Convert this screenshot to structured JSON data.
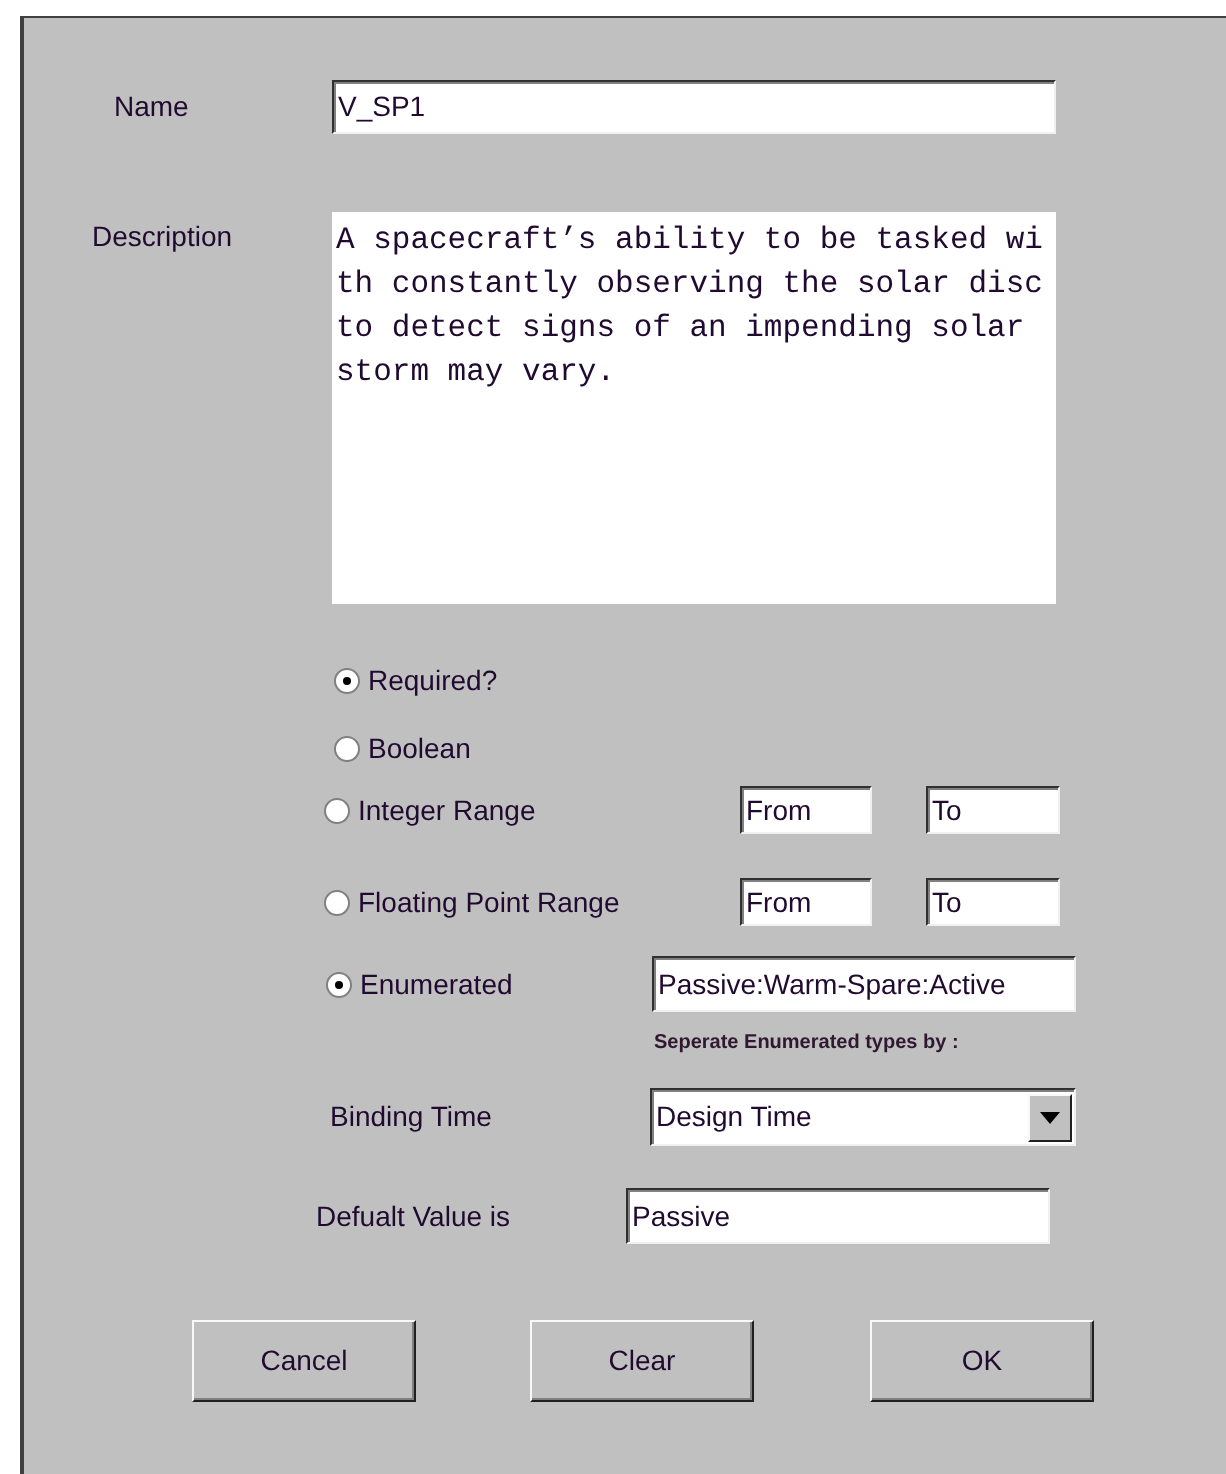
{
  "name": {
    "label": "Name",
    "value": "V_SP1"
  },
  "description": {
    "label": "Description",
    "value": "A spacecraft’s ability to be tasked with constantly observing the solar disc to detect signs of an impending solar storm may vary."
  },
  "options": [
    {
      "kind": "plain",
      "label": "Required?",
      "checked": true
    },
    {
      "kind": "plain",
      "label": "Boolean",
      "checked": false
    },
    {
      "kind": "range",
      "label": "Integer Range",
      "checked": false,
      "from": "From",
      "to": "To"
    },
    {
      "kind": "range",
      "label": "Floating Point Range",
      "checked": false,
      "from": "From",
      "to": "To"
    },
    {
      "kind": "enumerated",
      "label": "Enumerated",
      "checked": true,
      "value": "Passive:Warm-Spare:Active",
      "hint": "Seperate Enumerated types by :"
    }
  ],
  "binding_time": {
    "label": "Binding Time",
    "value": "Design Time"
  },
  "default_value": {
    "label": "Defualt Value is",
    "value": "Passive"
  },
  "buttons": [
    "Cancel",
    "Clear",
    "OK"
  ]
}
